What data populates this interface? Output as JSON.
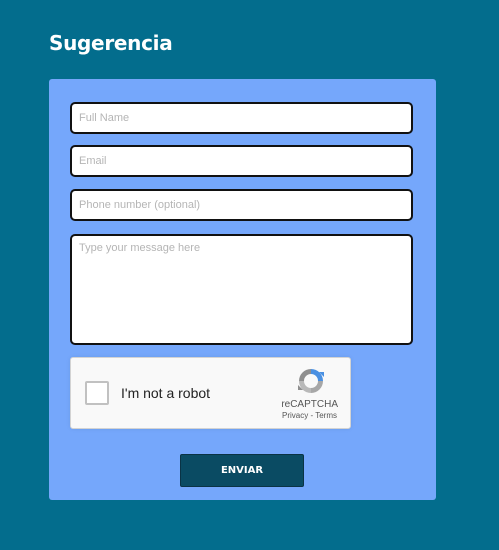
{
  "page": {
    "title": "Sugerencia"
  },
  "form": {
    "full_name_placeholder": "Full Name",
    "email_placeholder": "Email",
    "phone_placeholder": "Phone number (optional)",
    "message_placeholder": "Type your message here",
    "submit_label": "ENVIAR"
  },
  "captcha": {
    "label": "I'm not a robot",
    "brand": "reCAPTCHA",
    "privacy": "Privacy",
    "separator": " - ",
    "terms": "Terms",
    "icon": "recaptcha-logo-icon"
  },
  "colors": {
    "background": "#036d8d",
    "panel": "#75a7fb",
    "button": "#0a4b63"
  }
}
